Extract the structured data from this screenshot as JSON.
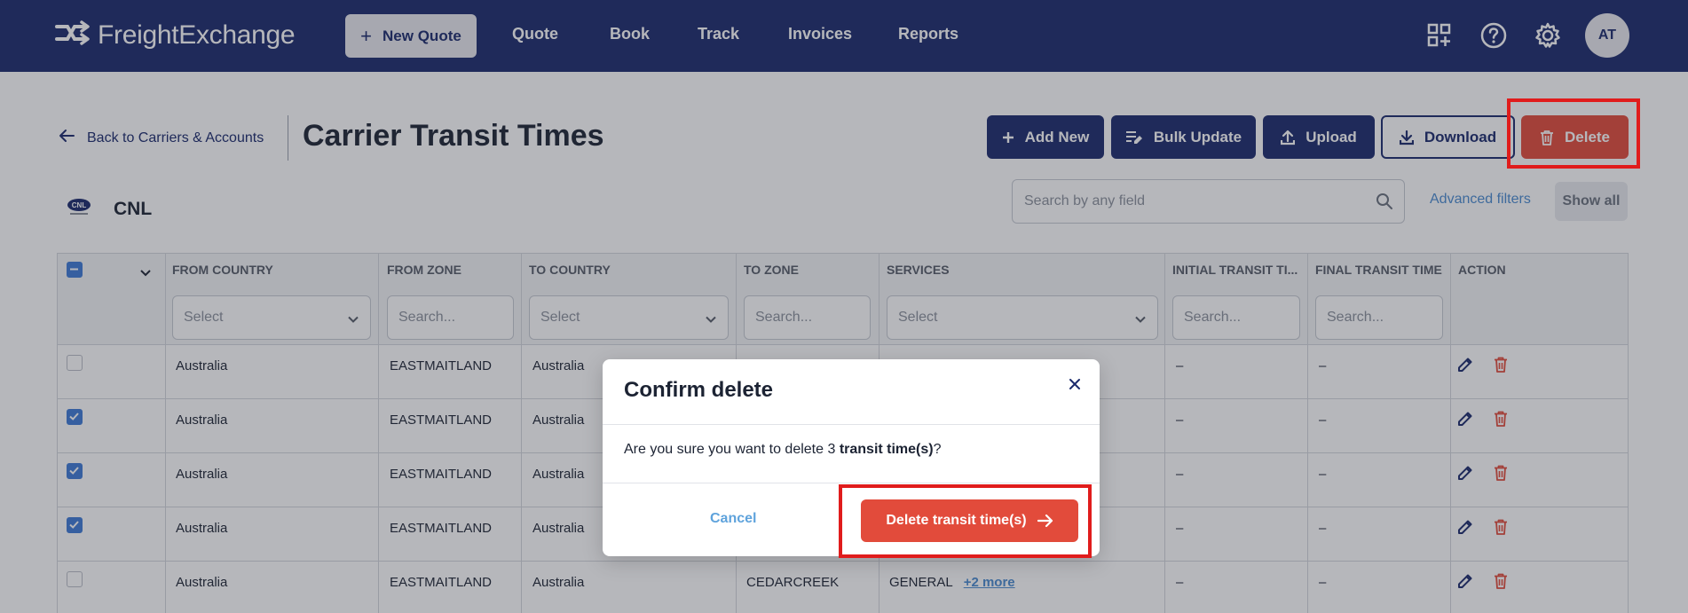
{
  "colors": {
    "nav_bg": "#1a2a6c",
    "primary": "#1a2a6c",
    "danger": "#e24b3b",
    "link": "#4a8bd0",
    "highlight": "#e01c1c",
    "checkbox": "#3d7ad6"
  },
  "nav": {
    "logo_text": "FreightExchange",
    "new_quote_label": "New Quote",
    "links": [
      "Quote",
      "Book",
      "Track",
      "Invoices",
      "Reports"
    ],
    "icons": [
      "apps-add-icon",
      "help-icon",
      "settings-icon"
    ],
    "avatar_initials": "AT"
  },
  "header": {
    "back_label": "Back to Carriers & Accounts",
    "title": "Carrier Transit Times",
    "buttons": {
      "add_new": "Add New",
      "bulk_update": "Bulk Update",
      "upload": "Upload",
      "download": "Download",
      "delete": "Delete"
    }
  },
  "carrier": {
    "logo_text": "CNL",
    "name": "CNL"
  },
  "search": {
    "placeholder": "Search by any field",
    "advanced_filters": "Advanced filters",
    "show_all": "Show all"
  },
  "table": {
    "columns": [
      "FROM COUNTRY",
      "FROM ZONE",
      "TO COUNTRY",
      "TO ZONE",
      "SERVICES",
      "INITIAL TRANSIT TI...",
      "FINAL TRANSIT TIME",
      "ACTION"
    ],
    "filters": {
      "from_country": "Select",
      "from_zone": "Search...",
      "to_country": "Select",
      "to_zone": "Search...",
      "services": "Select",
      "initial_transit": "Search...",
      "final_transit": "Search..."
    },
    "rows": [
      {
        "checked": false,
        "from_country": "Australia",
        "from_zone": "EASTMAITLAND",
        "to_country": "Australia",
        "to_zone": "",
        "services": "",
        "more": "",
        "initial": "–",
        "final": "–"
      },
      {
        "checked": true,
        "from_country": "Australia",
        "from_zone": "EASTMAITLAND",
        "to_country": "Australia",
        "to_zone": "",
        "services": "",
        "more": "",
        "initial": "–",
        "final": "–"
      },
      {
        "checked": true,
        "from_country": "Australia",
        "from_zone": "EASTMAITLAND",
        "to_country": "Australia",
        "to_zone": "",
        "services": "",
        "more": "",
        "initial": "–",
        "final": "–"
      },
      {
        "checked": true,
        "from_country": "Australia",
        "from_zone": "EASTMAITLAND",
        "to_country": "Australia",
        "to_zone": "",
        "services": "",
        "more": "",
        "initial": "–",
        "final": "–"
      },
      {
        "checked": false,
        "from_country": "Australia",
        "from_zone": "EASTMAITLAND",
        "to_country": "Australia",
        "to_zone": "CEDARCREEK",
        "services": "GENERAL",
        "more": "+2 more",
        "initial": "–",
        "final": "–"
      }
    ]
  },
  "modal": {
    "title": "Confirm delete",
    "body_prefix": "Are you sure you want to delete 3 ",
    "body_bold": "transit time(s)",
    "body_suffix": "?",
    "cancel_label": "Cancel",
    "confirm_label": "Delete transit time(s)"
  }
}
